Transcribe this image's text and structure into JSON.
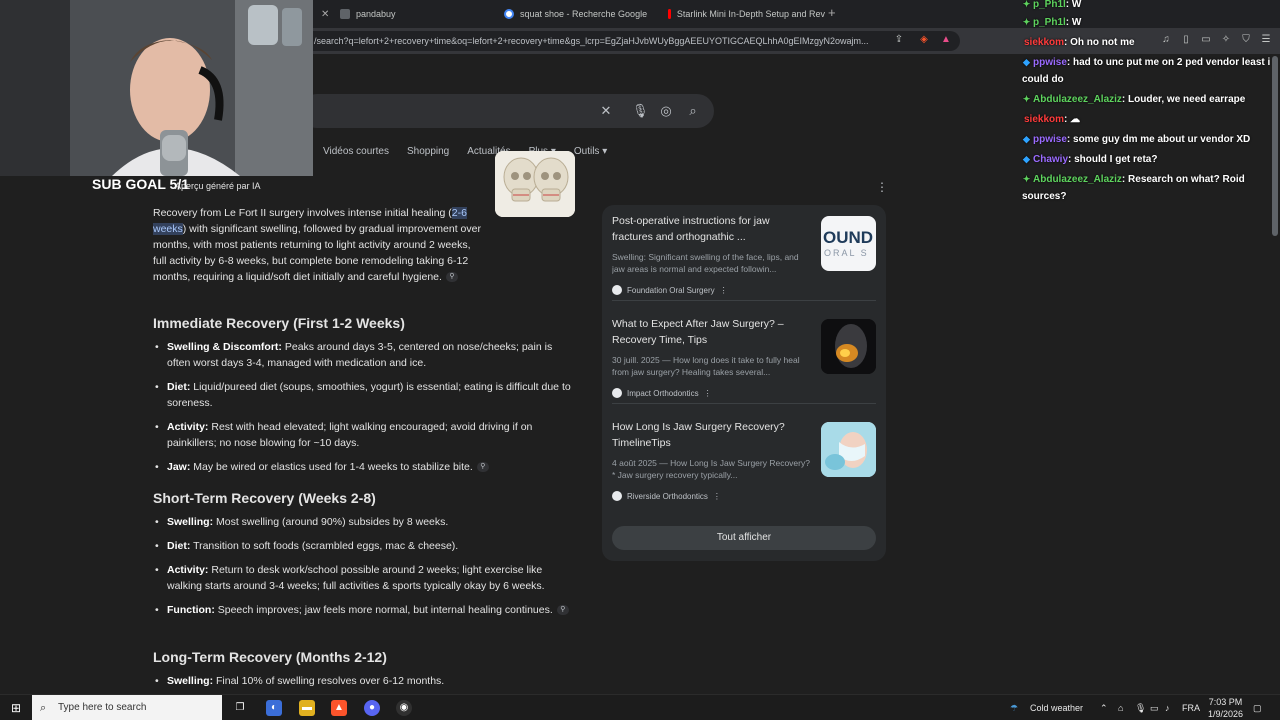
{
  "browser": {
    "tabs": [
      {
        "label": "pandabuy",
        "fav_color": "#5f6368"
      },
      {
        "label": "squat shoe - Recherche Google",
        "fav_color": "#4285f4"
      },
      {
        "label": "Starlink Mini In-Depth Setup and Rev",
        "fav_color": "#ff0000"
      }
    ],
    "address": "/search?q=lefort+2+recovery+time&oq=lefort+2+recovery+time&gs_lcrp=EgZjaHJvbWUyBggAEEUYOTIGCAEQLhhA0gEIMzgyN2owajm..."
  },
  "search": {
    "nav": [
      "s",
      "Vidéos courtes",
      "Shopping",
      "Actualités",
      "Plus ▾",
      "Outils ▾"
    ]
  },
  "stream": {
    "sub_goal": "SUB GOAL 5/1"
  },
  "ai_overview": {
    "label": "Aperçu généré par IA",
    "intro_pre": "Recovery from Le Fort II surgery involves intense initial healing (",
    "intro_hl": "2-6 weeks",
    "intro_post": ") with significant swelling, followed by gradual improvement over months, with most patients returning to light activity around 2 weeks, full activity by 6-8 weeks, but complete bone remodeling taking 6-12 months, requiring a liquid/soft diet initially and careful hygiene.",
    "sections": [
      {
        "title": "Immediate Recovery (First 1-2 Weeks)",
        "bullets": [
          {
            "k": "Swelling & Discomfort:",
            "v": " Peaks around days 3-5, centered on nose/cheeks; pain is often worst days 3-4, managed with medication and ice."
          },
          {
            "k": "Diet:",
            "v": " Liquid/pureed diet (soups, smoothies, yogurt) is essential; eating is difficult due to soreness."
          },
          {
            "k": "Activity:",
            "v": " Rest with head elevated; light walking encouraged; avoid driving if on painkillers; no nose blowing for ~10 days."
          },
          {
            "k": "Jaw:",
            "v": " May be wired or elastics used for 1-4 weeks to stabilize bite."
          }
        ]
      },
      {
        "title": "Short-Term Recovery (Weeks 2-8)",
        "bullets": [
          {
            "k": "Swelling:",
            "v": " Most swelling (around 90%) subsides by 8 weeks."
          },
          {
            "k": "Diet:",
            "v": " Transition to soft foods (scrambled eggs, mac & cheese)."
          },
          {
            "k": "Activity:",
            "v": " Return to desk work/school possible around 2 weeks; light exercise like walking starts around 3-4 weeks; full activities & sports typically okay by 6 weeks."
          },
          {
            "k": "Function:",
            "v": " Speech improves; jaw feels more normal, but internal healing continues."
          }
        ]
      },
      {
        "title": "Long-Term Recovery (Months 2-12)",
        "bullets": [
          {
            "k": "Swelling:",
            "v": " Final 10% of swelling resolves over 6-12 months."
          }
        ]
      }
    ]
  },
  "sources": {
    "cards": [
      {
        "title": "Post-operative instructions for jaw fractures and orthognathic ...",
        "snippet": "Swelling: Significant swelling of the face, lips, and jaw areas is normal and expected followin...",
        "source": "Foundation Oral Surgery"
      },
      {
        "title": "What to Expect After Jaw Surgery? – Recovery Time, Tips",
        "snippet": "30 juill. 2025 — How long does it take to fully heal from jaw surgery? Healing takes several...",
        "source": "Impact Orthodontics"
      },
      {
        "title": "How Long Is Jaw Surgery Recovery? TimelineTips",
        "snippet": "4 août 2025 — How Long Is Jaw Surgery Recovery? * Jaw surgery recovery typically...",
        "source": "Riverside Orthodontics"
      }
    ],
    "card1_logo_line1": "OUND",
    "card1_logo_line2": "ORAL S",
    "show_all": "Tout afficher"
  },
  "chat": [
    {
      "user": "p_Ph1l",
      "text": ": W",
      "color": "#5ed35e",
      "icon": "✦"
    },
    {
      "user": "p_Ph1l",
      "text": ": W",
      "color": "#5ed35e",
      "icon": "✦"
    },
    {
      "user": "siekkom",
      "text": ": Oh no not me",
      "color": "#ff3b3b",
      "icon": ""
    },
    {
      "user": "ppwise",
      "text": ": had to unc put me on 2 ped vendor least i could do",
      "color": "#9b6bff",
      "icon": "◆"
    },
    {
      "user": "Abdulazeez_Alaziz",
      "text": ": Louder, we need earrape",
      "color": "#5ed35e",
      "icon": "✦"
    },
    {
      "user": "siekkom",
      "text": ": ",
      "color": "#ff3b3b",
      "icon": ""
    },
    {
      "user": "ppwise",
      "text": ": some guy dm me about ur vendor XD",
      "color": "#9b6bff",
      "icon": "◆"
    },
    {
      "user": "Chawiy",
      "text": ": should I get reta?",
      "color": "#9b6bff",
      "icon": "◆"
    },
    {
      "user": "Abdulazeez_Alaziz",
      "text": ": Research on what? Roid sources?",
      "color": "#5ed35e",
      "icon": "✦"
    }
  ],
  "taskbar": {
    "search_placeholder": "Type here to search",
    "weather": "Cold weather",
    "lang": "FRA",
    "time": "7:03 PM",
    "date": "1/9/2026"
  }
}
